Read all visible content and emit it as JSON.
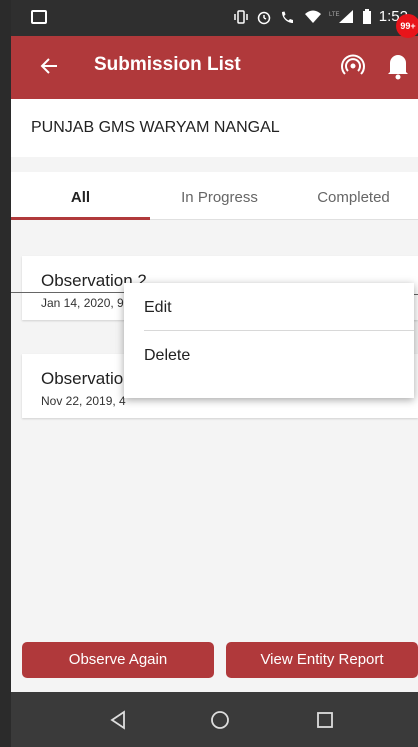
{
  "status_bar": {
    "time": "1:52",
    "icons": [
      "vibrate-icon",
      "alarm-icon",
      "lte-call-icon",
      "wifi-icon",
      "lte-signal-icon",
      "battery-icon"
    ]
  },
  "header": {
    "title": "Submission List",
    "badge_count": "99+",
    "colors": {
      "primary": "#b0393b",
      "badge": "#e8141a"
    }
  },
  "entity": {
    "name": "PUNJAB GMS WARYAM NANGAL"
  },
  "tabs": [
    {
      "label": "All",
      "active": true
    },
    {
      "label": "In Progress",
      "active": false
    },
    {
      "label": "Completed",
      "active": false
    }
  ],
  "submissions": [
    {
      "title": "Observation 2",
      "date": "Jan 14, 2020, 9"
    },
    {
      "title": "Observation",
      "date": "Nov 22, 2019, 4"
    }
  ],
  "menu": {
    "edit": "Edit",
    "delete": "Delete"
  },
  "footer": {
    "observe_again": "Observe Again",
    "view_entity_report": "View Entity Report"
  }
}
